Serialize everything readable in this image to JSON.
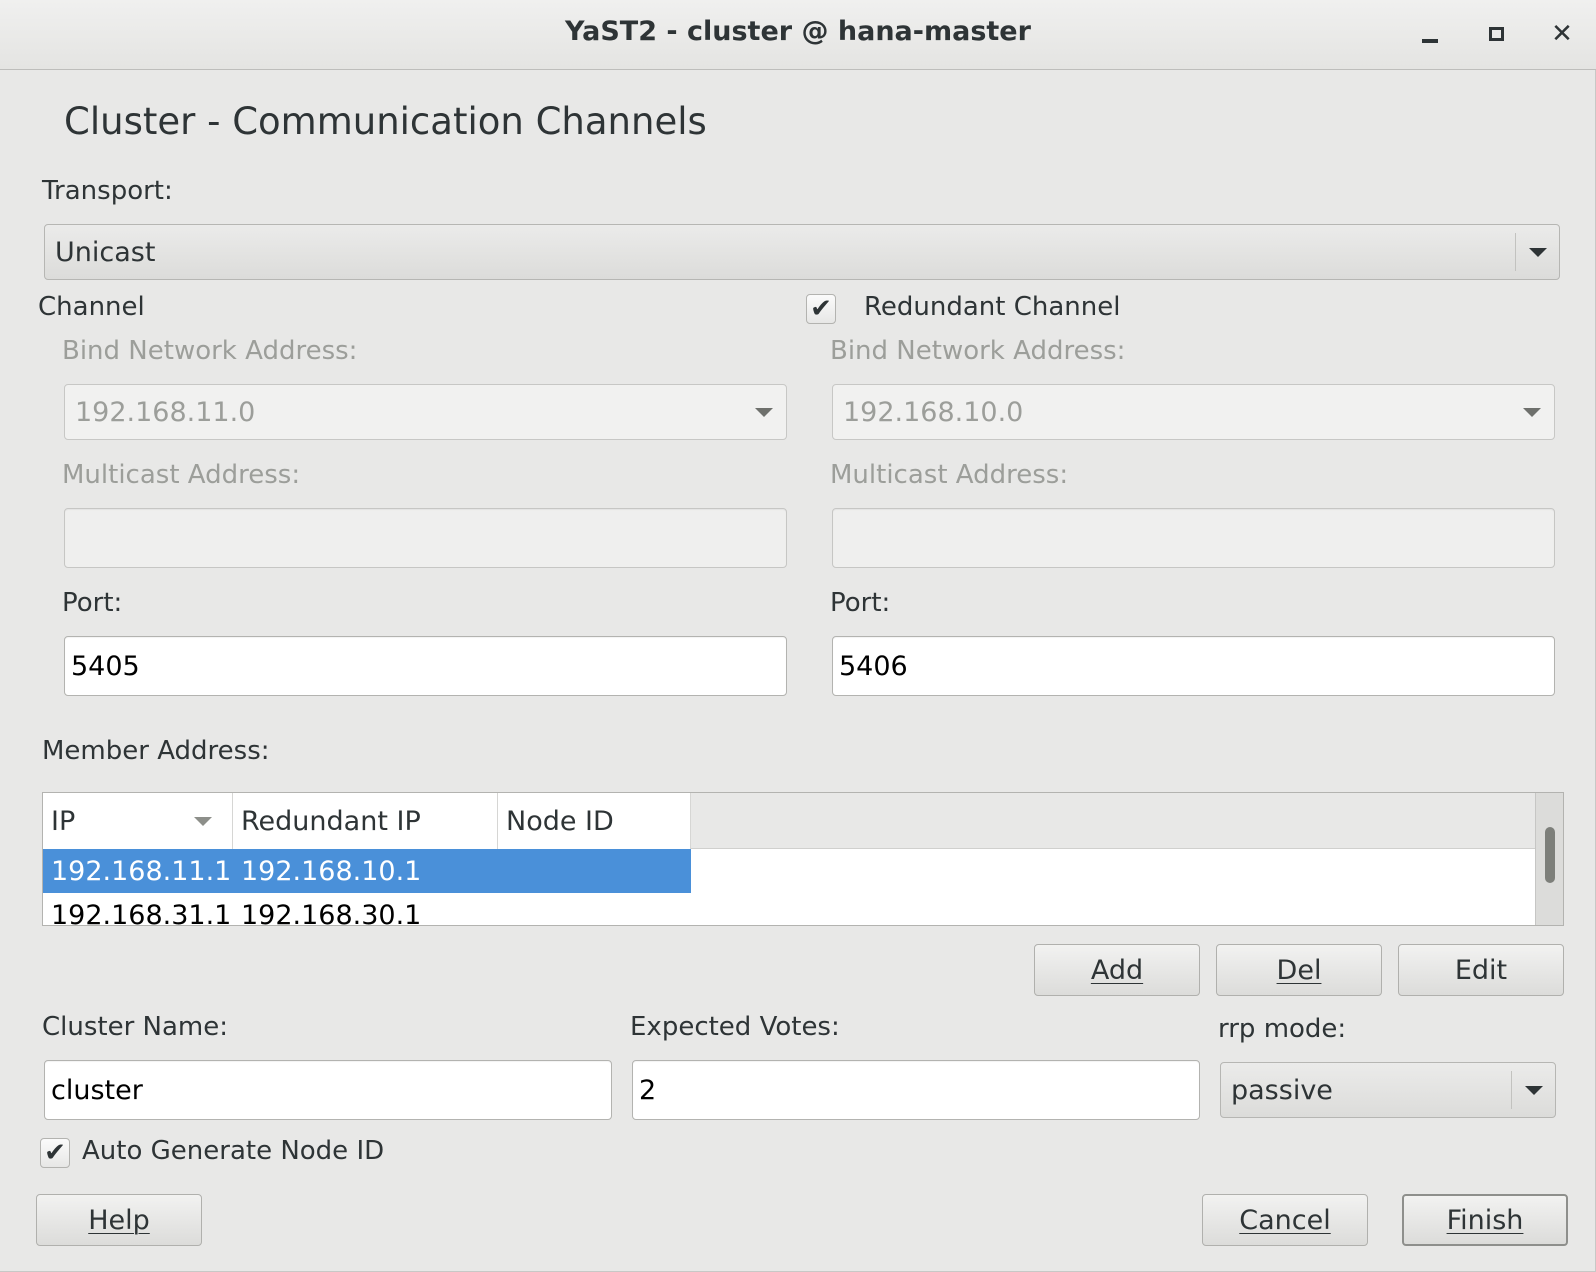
{
  "window": {
    "title": "YaST2 - cluster @ hana-master"
  },
  "heading": "Cluster - Communication Channels",
  "transport": {
    "label": "Transport:",
    "value": "Unicast"
  },
  "channel": {
    "title": "Channel",
    "bind_label": "Bind Network Address:",
    "bind_value": "192.168.11.0",
    "multicast_label": "Multicast Address:",
    "multicast_value": "",
    "port_label": "Port:",
    "port_value": "5405"
  },
  "redundant_channel": {
    "checked": true,
    "title": "Redundant Channel",
    "bind_label": "Bind Network Address:",
    "bind_value": "192.168.10.0",
    "multicast_label": "Multicast Address:",
    "multicast_value": "",
    "port_label": "Port:",
    "port_value": "5406"
  },
  "member_address": {
    "label": "Member Address:",
    "columns": [
      "IP",
      "Redundant IP",
      "Node ID"
    ],
    "rows": [
      {
        "ip": "192.168.11.1",
        "redundant_ip": "192.168.10.1",
        "node_id": ""
      },
      {
        "ip": "192.168.31.1",
        "redundant_ip": "192.168.30.1",
        "node_id": ""
      }
    ],
    "selected_row": 0,
    "buttons": {
      "add": "Add",
      "del": "Del",
      "edit": "Edit"
    }
  },
  "cluster_name": {
    "label": "Cluster Name:",
    "value": "cluster"
  },
  "expected_votes": {
    "label": "Expected Votes:",
    "value": "2"
  },
  "rrp_mode": {
    "label": "rrp mode:",
    "value": "passive"
  },
  "auto_generate": {
    "checked": true,
    "label": "Auto Generate Node ID"
  },
  "footer": {
    "help": "Help",
    "cancel": "Cancel",
    "finish": "Finish"
  },
  "colors": {
    "selection": "#4a90d9",
    "window_bg": "#e8e8e7"
  }
}
